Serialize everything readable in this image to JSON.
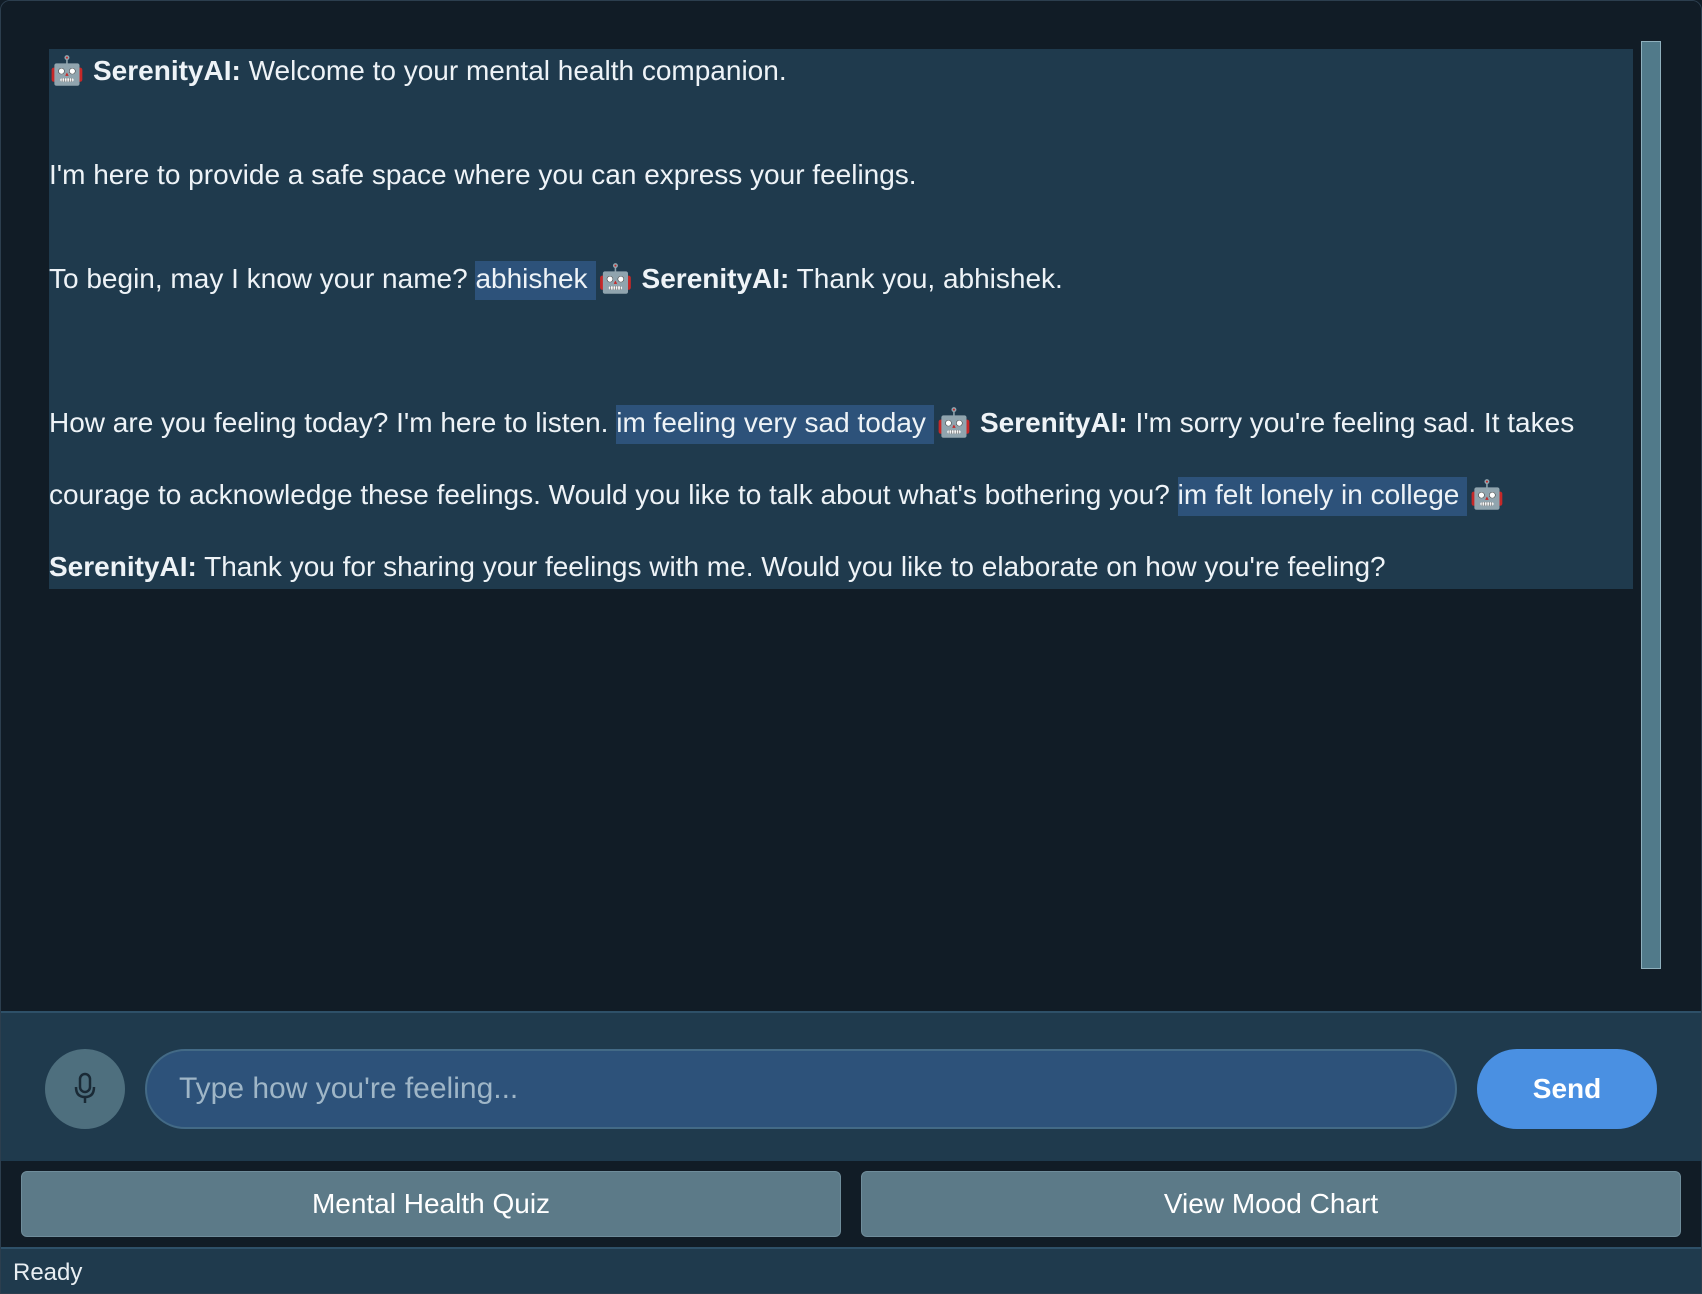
{
  "chat": {
    "assistant_name": "SerenityAI:",
    "welcome": "Welcome to your mental health companion.",
    "intro": "I'm here to provide a safe space where you can express your feelings.",
    "ask_name": "To begin, may I know your name?",
    "user_name_reply": "abhishek",
    "thank_name": "Thank you, abhishek.",
    "ask_feeling": "How are you feeling today? I'm here to listen.",
    "user_feeling_reply": "im feeling very sad today",
    "sad_response_part1": "I'm sorry you're feeling sad. It takes",
    "sad_response_part2": "courage to acknowledge these feelings. Would you like to talk about what's bothering you?",
    "user_lonely_reply": "im felt lonely in college",
    "elaborate_response": "Thank you for sharing your feelings with me. Would you like to elaborate on how you're feeling?"
  },
  "input": {
    "placeholder": "Type how you're feeling...",
    "send_label": "Send"
  },
  "actions": {
    "quiz_label": "Mental Health Quiz",
    "mood_chart_label": "View Mood Chart"
  },
  "status": {
    "text": "Ready"
  },
  "icons": {
    "assistant": "robot-icon",
    "mic": "microphone-icon"
  },
  "colors": {
    "accent": "#4a90e2",
    "user_bubble": "#2d527a",
    "transcript_bg": "#1f3a4d",
    "background": "#111c26"
  }
}
